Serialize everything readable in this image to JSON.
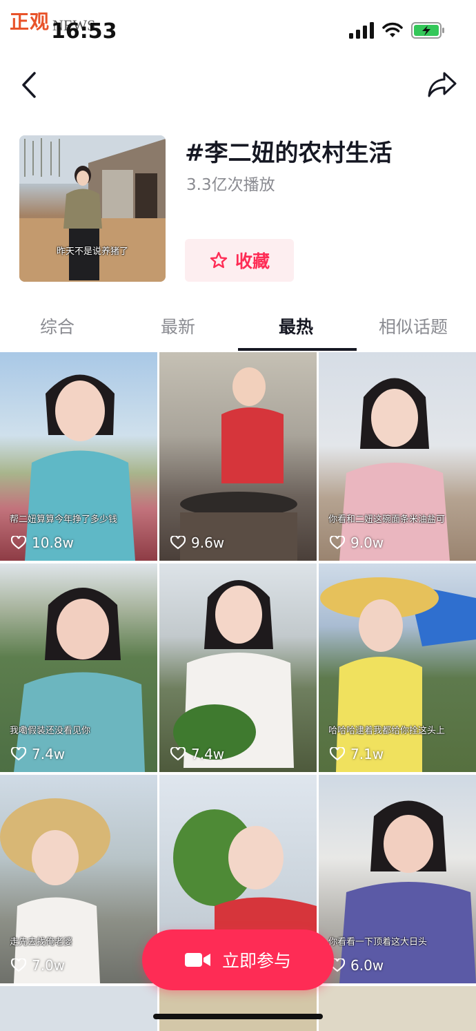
{
  "status_bar": {
    "watermark_cn": "正观",
    "watermark_en": "NEWS",
    "time": "16:53",
    "battery_color": "#34c759"
  },
  "header": {
    "back_icon": "chevron-left-icon",
    "share_icon": "share-arrow-icon"
  },
  "topic": {
    "cover_caption": "昨天不是说养猪了",
    "title": "#李二妞的农村生活",
    "plays": "3.3亿次播放",
    "favorite_label": "收藏",
    "favorite_icon": "star-outline-icon"
  },
  "tabs": [
    "综合",
    "最新",
    "最热",
    "相似话题"
  ],
  "active_tab": 2,
  "videos": [
    {
      "caption": "帮二妞算算今年挣了多少钱",
      "likes": "10.8w"
    },
    {
      "caption": "",
      "likes": "9.6w"
    },
    {
      "caption": "你看和二妞这碗面条米油盐可",
      "likes": "9.0w"
    },
    {
      "caption": "我嘞假装还没看见你",
      "likes": "7.4w"
    },
    {
      "caption": "",
      "likes": "7.4w"
    },
    {
      "caption": "哈哈哈逮着我都给你拴这头上",
      "likes": "7.1w"
    },
    {
      "caption": "走先去找俺老婆",
      "likes": "7.0w"
    },
    {
      "caption": "",
      "likes": ""
    },
    {
      "caption": "你看看一下顶着这大日头",
      "likes": "6.0w"
    }
  ],
  "cta": {
    "label": "立即参与",
    "icon": "video-camera-icon"
  },
  "colors": {
    "accent": "#fe2c55",
    "accent_light": "#fdeef0",
    "text_primary": "#161823",
    "text_secondary": "#8a8b91"
  }
}
